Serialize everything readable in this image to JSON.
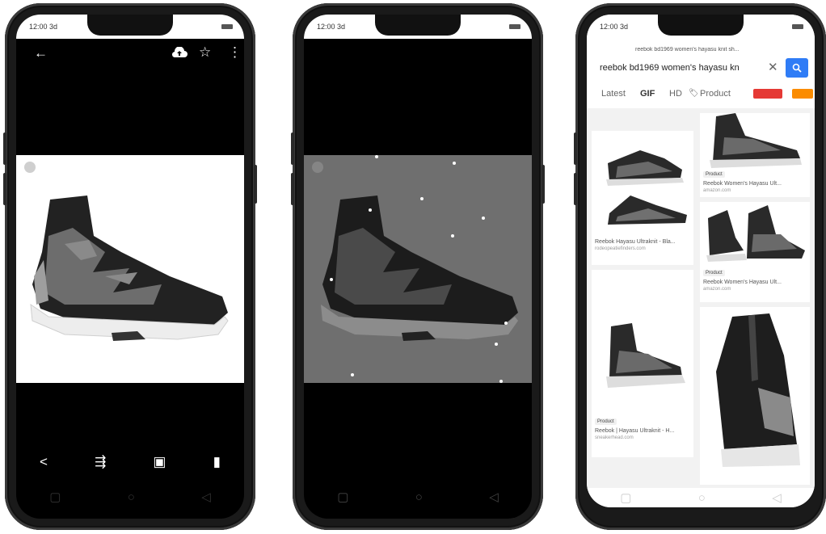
{
  "status": {
    "time": "12:00 3d"
  },
  "phone1": {
    "toolbar_icons": [
      "back-arrow-icon",
      "cloud-upload-icon",
      "star-icon",
      "more-vert-icon"
    ],
    "bottom_actions": [
      {
        "name": "share-icon",
        "glyph": "<"
      },
      {
        "name": "adjust-icon",
        "glyph": "⇶"
      },
      {
        "name": "lens-icon",
        "glyph": "▣"
      },
      {
        "name": "delete-icon",
        "glyph": "▮"
      }
    ]
  },
  "phone3": {
    "page_title": "reebok bd1969 women's hayasu knit sh...",
    "search_value": "reebok bd1969 women's hayasu kn",
    "chips": [
      "Latest",
      "GIF",
      "HD",
      "Product"
    ],
    "chip_colors": [
      "#e53935",
      "#fb8c00"
    ],
    "results": [
      {
        "caption": "Reebok Hayasu Ultraknit - Bla...",
        "source": "rodeopeatiefinders.com"
      },
      {
        "tag": "Product",
        "caption": "Reebok Women's Hayasu Ult...",
        "source": "amazon.com"
      },
      {
        "tag": "Product",
        "caption": "Reebok Women's Hayasu Ult...",
        "source": "amazon.com"
      },
      {
        "tag": "Product",
        "caption": "Reebok | Hayasu Ultraknit - H...",
        "source": "sneakerhead.com"
      }
    ]
  }
}
